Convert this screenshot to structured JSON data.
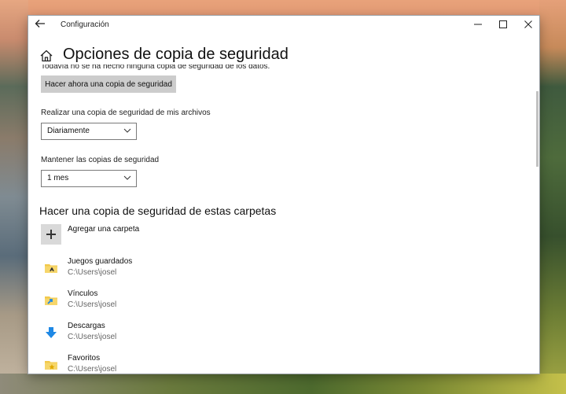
{
  "window": {
    "title": "Configuración",
    "back_icon": "back-arrow-icon",
    "controls": {
      "minimize": "—",
      "maximize": "☐",
      "close": "✕"
    }
  },
  "header": {
    "home_icon": "home-icon",
    "title": "Opciones de copia de seguridad"
  },
  "content": {
    "clipped_text": "Todavía no se ha hecho ninguna copia de seguridad de los datos.",
    "backup_now_button": "Hacer ahora una copia de seguridad",
    "frequency": {
      "label": "Realizar una copia de seguridad de mis archivos",
      "value": "Diariamente"
    },
    "retention": {
      "label": "Mantener las copias de seguridad",
      "value": "1 mes"
    },
    "folders_section_title": "Hacer una copia de seguridad de estas carpetas",
    "add_folder_label": "Agregar una carpeta",
    "folders": [
      {
        "name": "Juegos guardados",
        "path": "C:\\Users\\josel",
        "icon": "saved-games-folder-icon"
      },
      {
        "name": "Vínculos",
        "path": "C:\\Users\\josel",
        "icon": "links-folder-icon"
      },
      {
        "name": "Descargas",
        "path": "C:\\Users\\josel",
        "icon": "downloads-icon"
      },
      {
        "name": "Favoritos",
        "path": "C:\\Users\\josel",
        "icon": "favorites-folder-icon"
      }
    ]
  },
  "colors": {
    "button_bg": "#cccccc",
    "accent_blue": "#1e88e5",
    "folder_yellow": "#f2c94c"
  }
}
